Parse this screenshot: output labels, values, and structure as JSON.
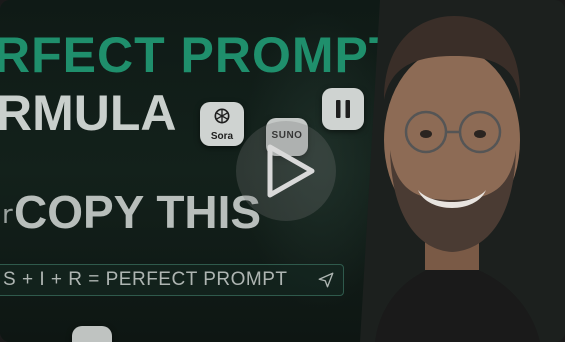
{
  "thumbnail": {
    "headline_line1": "RFECT PROMPT",
    "headline_line2": "RMULA",
    "copy_label": "COPY THIS",
    "copy_mark": "r",
    "formula": "S + I + R = PERFECT PROMPT"
  },
  "tiles": {
    "sora_label": "Sora",
    "suno_label": "SUNO"
  },
  "colors": {
    "headline_green": "#1f8f6c",
    "headline_grey": "#c9cfcc",
    "background": "#13211b"
  },
  "icons": {
    "play": "play-icon",
    "send": "send-icon",
    "sora": "sora-logo-icon",
    "pause": "pause-icon"
  }
}
